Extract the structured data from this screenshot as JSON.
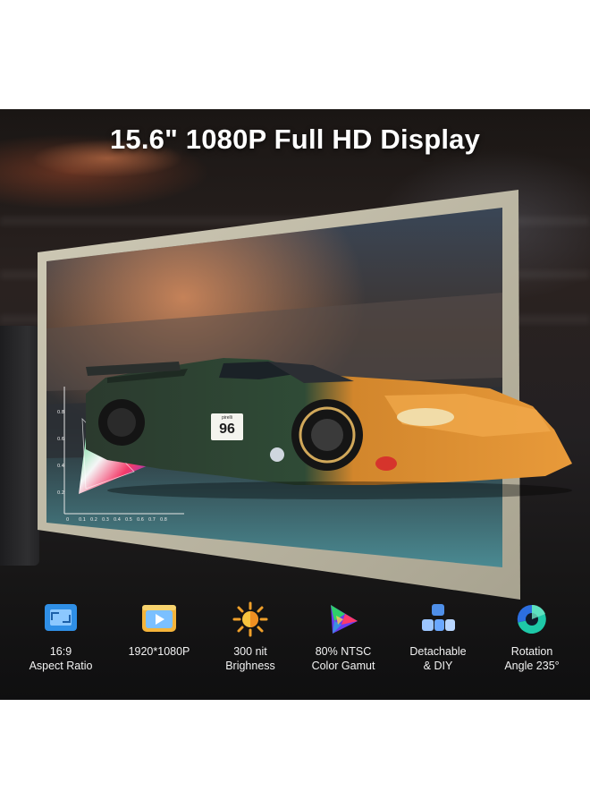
{
  "headline": "15.6\" 1080P Full HD Display",
  "features": [
    {
      "icon": "aspect-ratio-icon",
      "line1": "16:9",
      "line2": "Aspect Ratio"
    },
    {
      "icon": "resolution-play-icon",
      "line1": "1920*1080P",
      "line2": ""
    },
    {
      "icon": "brightness-sun-icon",
      "line1": "300 nit",
      "line2": "Brighness"
    },
    {
      "icon": "color-gamut-icon",
      "line1": "80% NTSC",
      "line2": "Color Gamut"
    },
    {
      "icon": "detachable-blocks-icon",
      "line1": "Detachable",
      "line2": "& DIY"
    },
    {
      "icon": "rotation-icon",
      "line1": "Rotation",
      "line2": "Angle 235°"
    }
  ],
  "race_car": {
    "number": "96",
    "sponsor_text": "pirelli"
  },
  "gamut_axis": {
    "y_ticks": [
      "0.8",
      "0.6",
      "0.4",
      "0.2"
    ],
    "x_ticks": [
      "0",
      "0.1",
      "0.2",
      "0.3",
      "0.4",
      "0.5",
      "0.6",
      "0.7",
      "0.8"
    ]
  },
  "colors": {
    "accent_blue": "#3a8fe0",
    "orange_car": "#d98a2e",
    "frame": "#b8b3a0"
  }
}
